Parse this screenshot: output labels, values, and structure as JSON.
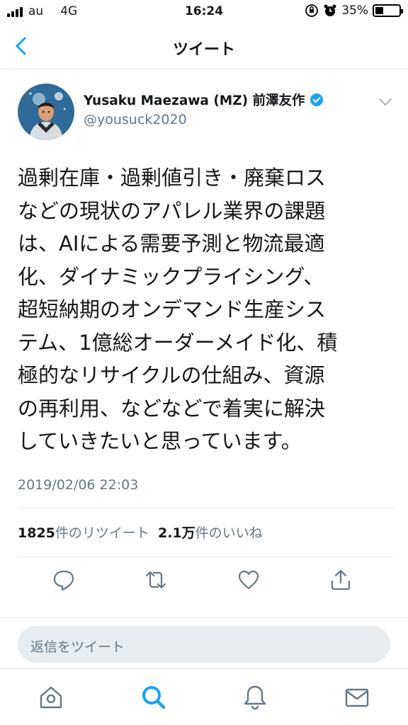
{
  "status_bar": {
    "carrier": "au",
    "network": "4G",
    "time": "16:24",
    "battery_percent": "35%",
    "battery_level": 0.35
  },
  "nav": {
    "title": "ツイート",
    "back_icon": "chevron-left-icon"
  },
  "tweet": {
    "author_name": "Yusaku Maezawa (MZ) 前澤友作",
    "author_handle": "@yousuck2020",
    "verified": true,
    "lines": [
      "過剰在庫・過剰値引き・廃棄ロス",
      "などの現状のアパレル業界の課題",
      "は、AIによる需要予測と物流最適",
      "化、ダイナミックプライシング、",
      "超短納期のオンデマンド生産シス",
      "テム、1億総オーダーメイド化、積",
      "極的なリサイクルの仕組み、資源",
      "の再利用、などなどで着実に解決",
      "していきたいと思っています。"
    ],
    "timestamp": "2019/02/06 22:03"
  },
  "stats": {
    "retweet_count": "1825",
    "retweet_label": "件のリツイート",
    "like_count": "2.1万",
    "like_label": "件のいいね"
  },
  "reply": {
    "placeholder": "返信をツイート"
  },
  "colors": {
    "accent": "#1da1f2",
    "text": "#14171a",
    "secondary_text": "#657786",
    "divider": "#e1e8ed",
    "input_bg": "#e6ecf0"
  },
  "tabs": [
    "home-icon",
    "search-icon",
    "notifications-icon",
    "messages-icon"
  ],
  "active_tab": "search-icon"
}
